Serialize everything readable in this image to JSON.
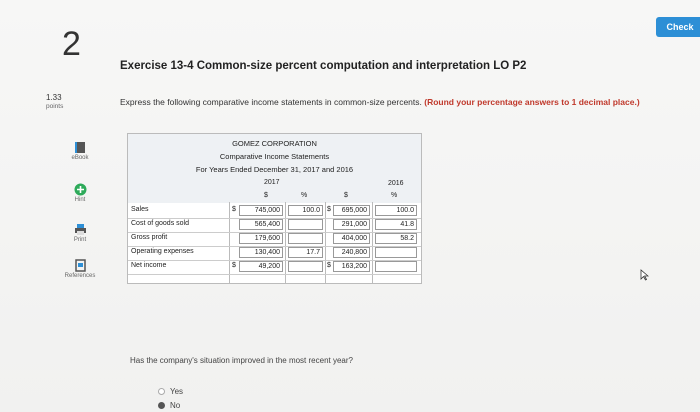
{
  "header": {
    "check_label": "Check",
    "question_number": "2"
  },
  "exercise": {
    "title": "Exercise 13-4 Common-size percent computation and interpretation LO P2"
  },
  "points": {
    "value": "1.33",
    "label": "points"
  },
  "instructions": {
    "text": "Express the following comparative income statements in common-size percents.",
    "highlight": "(Round your percentage answers to 1 decimal place.)"
  },
  "sidebar": {
    "items": [
      {
        "label": "eBook",
        "icon": "ebook-icon"
      },
      {
        "label": "Hint",
        "icon": "hint-icon"
      },
      {
        "label": "Print",
        "icon": "print-icon"
      },
      {
        "label": "References",
        "icon": "references-icon"
      }
    ]
  },
  "table": {
    "company": "GOMEZ CORPORATION",
    "statement": "Comparative Income Statements",
    "period": "For Years Ended December 31, 2017 and 2016",
    "year1": "2017",
    "year2": "2016",
    "col_dollar": "$",
    "col_percent": "%",
    "rows": [
      {
        "label": "Sales",
        "prefix1": "$",
        "amount1": "745,000",
        "pct1": "100.0",
        "prefix2": "$",
        "amount2": "695,000",
        "pct2": "100.0"
      },
      {
        "label": "Cost of goods sold",
        "prefix1": "",
        "amount1": "565,400",
        "pct1": "",
        "prefix2": "",
        "amount2": "291,000",
        "pct2": "41.8"
      },
      {
        "label": "Gross profit",
        "prefix1": "",
        "amount1": "179,600",
        "pct1": "",
        "prefix2": "",
        "amount2": "404,000",
        "pct2": "58.2"
      },
      {
        "label": "Operating expenses",
        "prefix1": "",
        "amount1": "130,400",
        "pct1": "17.7",
        "prefix2": "",
        "amount2": "240,800",
        "pct2": ""
      },
      {
        "label": "Net income",
        "prefix1": "$",
        "amount1": "49,200",
        "pct1": "",
        "prefix2": "$",
        "amount2": "163,200",
        "pct2": ""
      }
    ]
  },
  "question": {
    "text": "Has the company's situation improved in the most recent year?",
    "options": [
      {
        "label": "Yes",
        "selected": false
      },
      {
        "label": "No",
        "selected": true
      }
    ]
  }
}
